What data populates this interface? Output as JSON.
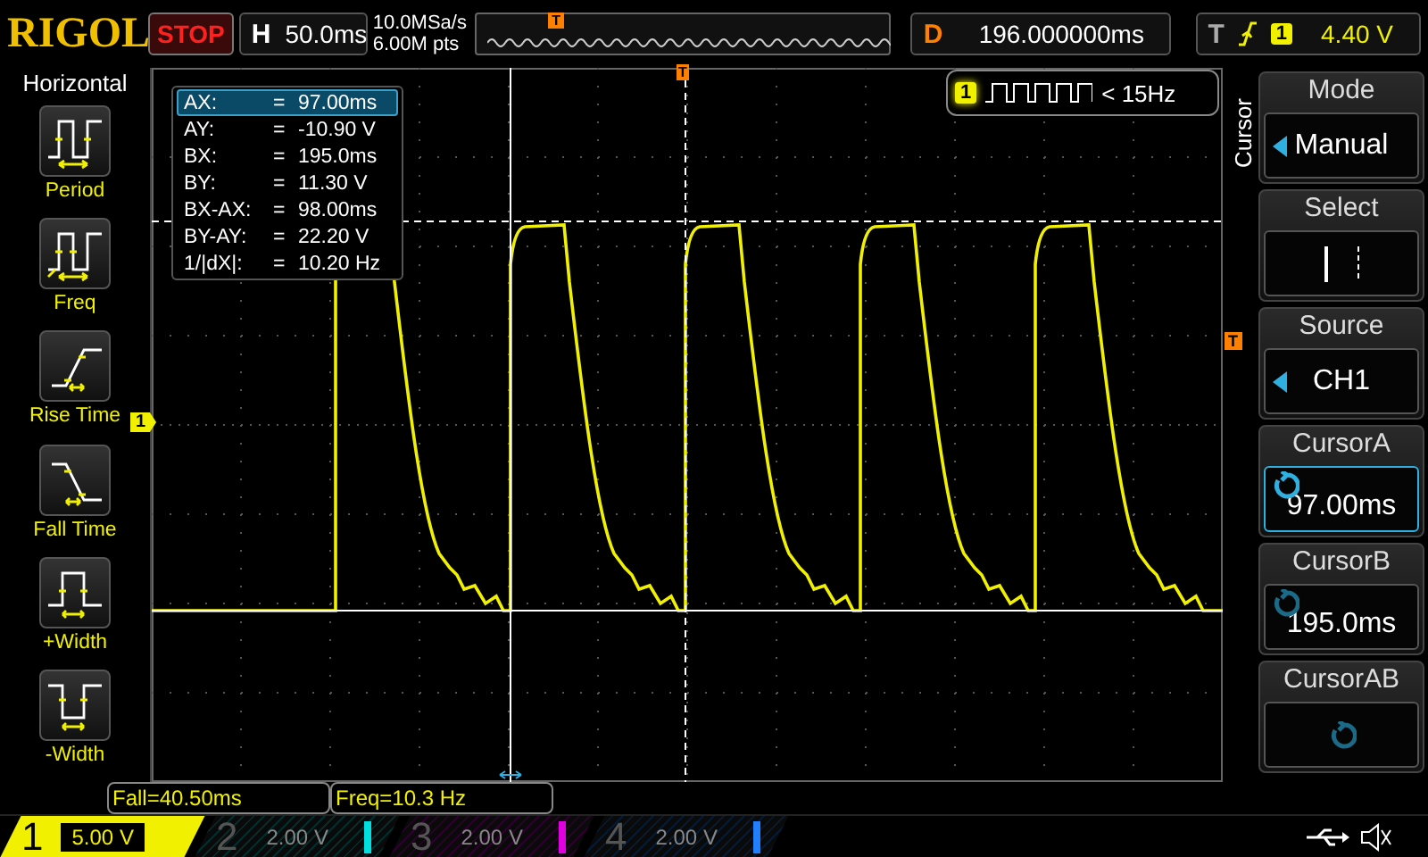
{
  "top_bar": {
    "logo": "RIGOL",
    "run_state": "STOP",
    "timebase": {
      "label": "H",
      "value": "50.0ms"
    },
    "sample_rate": "10.0MSa/s",
    "memory_depth": "6.00M pts",
    "trigger_marker": "T",
    "delay": {
      "label": "D",
      "value": "196.000000ms"
    },
    "trigger": {
      "label": "T",
      "source": "1",
      "level": "4.40 V"
    }
  },
  "left_menu": {
    "title": "Horizontal",
    "items": [
      {
        "kind": "period",
        "label": "Period"
      },
      {
        "kind": "freq",
        "label": "Freq"
      },
      {
        "kind": "rise",
        "label": "Rise Time"
      },
      {
        "kind": "fall",
        "label": "Fall Time"
      },
      {
        "kind": "pwidth",
        "label": "+Width"
      },
      {
        "kind": "nwidth",
        "label": "-Width"
      }
    ]
  },
  "cursor_readout": [
    {
      "label": "AX:",
      "eq": "=",
      "value": "97.00ms",
      "selected": true
    },
    {
      "label": "AY:",
      "eq": "=",
      "value": "-10.90 V",
      "selected": false
    },
    {
      "label": "BX:",
      "eq": "=",
      "value": "195.0ms",
      "selected": false
    },
    {
      "label": "BY:",
      "eq": "=",
      "value": "11.30 V",
      "selected": false
    },
    {
      "label": "BX-AX:",
      "eq": "=",
      "value": "98.00ms",
      "selected": false
    },
    {
      "label": "BY-AY:",
      "eq": "=",
      "value": "22.20 V",
      "selected": false
    },
    {
      "label": "1/|dX|:",
      "eq": "=",
      "value": "10.20 Hz",
      "selected": false
    }
  ],
  "counter": {
    "channel": "1",
    "value": "< 15Hz"
  },
  "markers": {
    "channel": "1",
    "trigger_top": "T",
    "trigger_right": "T"
  },
  "right_menu": {
    "title": "Cursor",
    "softkeys": [
      {
        "kind": "select",
        "title": "Mode",
        "value": "Manual",
        "active": false
      },
      {
        "kind": "lines",
        "title": "Select",
        "active": false
      },
      {
        "kind": "select",
        "title": "Source",
        "value": "CH1",
        "active": false
      },
      {
        "kind": "knob",
        "title": "CursorA",
        "value": "97.00ms",
        "active": true
      },
      {
        "kind": "knob",
        "title": "CursorB",
        "value": "195.0ms",
        "active": false
      },
      {
        "kind": "knob",
        "title": "CursorAB",
        "active": false
      }
    ]
  },
  "measurements": [
    "Fall=40.50ms",
    "Freq=10.3 Hz"
  ],
  "channels": [
    {
      "number": "1",
      "scale": "5.00 V",
      "on": true,
      "color": "#f0f000"
    },
    {
      "number": "2",
      "scale": "2.00 V",
      "on": false,
      "color": "#00e0e0"
    },
    {
      "number": "3",
      "scale": "2.00 V",
      "on": false,
      "color": "#e000e0"
    },
    {
      "number": "4",
      "scale": "2.00 V",
      "on": false,
      "color": "#2080ff"
    }
  ]
}
